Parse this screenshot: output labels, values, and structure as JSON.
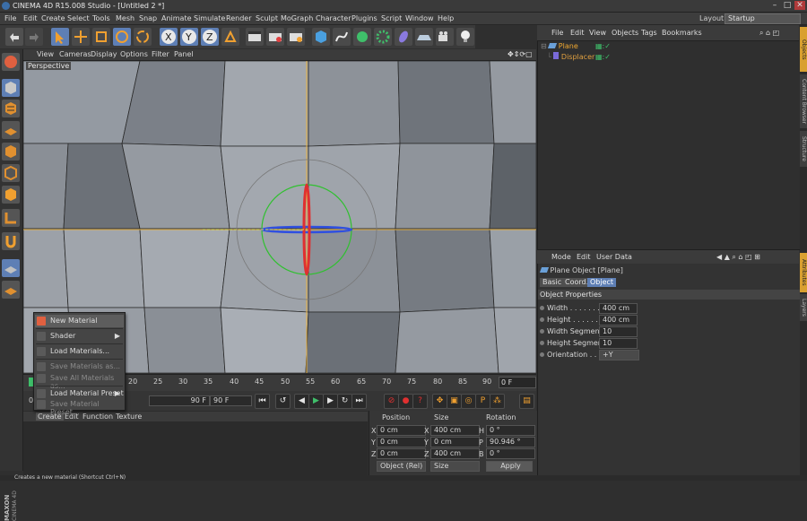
{
  "window": {
    "title": "CINEMA 4D R15.008 Studio - [Untitled 2 *]",
    "min": "–",
    "max": "□",
    "close": "✕"
  },
  "menubar": {
    "items": [
      "File",
      "Edit",
      "Create",
      "Select",
      "Tools",
      "Mesh",
      "Snap",
      "Animate",
      "Simulate",
      "Render",
      "Sculpt",
      "MoGraph",
      "Character",
      "Plugins",
      "Script",
      "Window",
      "Help"
    ],
    "layout_label": "Layout:",
    "layout_value": "Startup"
  },
  "viewport": {
    "menu": [
      "View",
      "Cameras",
      "Display",
      "Options",
      "Filter",
      "Panel"
    ],
    "label": "Perspective"
  },
  "timeline": {
    "ticks": [
      "20",
      "25",
      "30",
      "35",
      "40",
      "45",
      "50",
      "55",
      "60",
      "65",
      "70",
      "75",
      "80",
      "85",
      "90"
    ],
    "start_marker": "0",
    "frame_field": "0 F",
    "end_field_1": "90 F",
    "end_field_2": "90 F"
  },
  "context_menu": {
    "items": [
      {
        "label": "New Material",
        "highlight": true,
        "disabled": false,
        "sub": false
      },
      {
        "label": "Shader",
        "highlight": false,
        "disabled": false,
        "sub": true
      },
      {
        "label": "Load Materials...",
        "highlight": false,
        "disabled": false,
        "sub": false
      },
      {
        "label": "Save Materials as...",
        "highlight": false,
        "disabled": true,
        "sub": false
      },
      {
        "label": "Save All Materials as...",
        "highlight": false,
        "disabled": true,
        "sub": false
      },
      {
        "label": "Load Material Preset",
        "highlight": false,
        "disabled": false,
        "sub": true
      },
      {
        "label": "Save Material Preset...",
        "highlight": false,
        "disabled": true,
        "sub": false
      }
    ],
    "arrow": "▶"
  },
  "material_manager": {
    "menu": [
      "Create",
      "Edit",
      "Function",
      "Texture"
    ]
  },
  "coordinates": {
    "headers": [
      "Position",
      "Size",
      "Rotation"
    ],
    "rows": [
      {
        "axis": "X",
        "pos": "0 cm",
        "size_axis": "X",
        "size": "400 cm",
        "rot_axis": "H",
        "rot": "0 °"
      },
      {
        "axis": "Y",
        "pos": "0 cm",
        "size_axis": "Y",
        "size": "0 cm",
        "rot_axis": "P",
        "rot": "90.946 °"
      },
      {
        "axis": "Z",
        "pos": "0 cm",
        "size_axis": "Z",
        "size": "400 cm",
        "rot_axis": "B",
        "rot": "0 °"
      }
    ],
    "mode_select": "Object (Rel)",
    "size_select": "Size",
    "apply": "Apply"
  },
  "object_manager": {
    "menu": [
      "File",
      "Edit",
      "View",
      "Objects",
      "Tags",
      "Bookmarks"
    ],
    "objects": [
      {
        "name": "Plane",
        "indent": 0,
        "color": "#f0a830"
      },
      {
        "name": "Displacer",
        "indent": 1,
        "color": "#e0a040"
      }
    ]
  },
  "attributes": {
    "menu": [
      "Mode",
      "Edit",
      "User Data"
    ],
    "object_title": "Plane Object [Plane]",
    "tabs": [
      {
        "label": "Basic",
        "active": false
      },
      {
        "label": "Coord.",
        "active": false
      },
      {
        "label": "Object",
        "active": true
      }
    ],
    "section": "Object Properties",
    "props": [
      {
        "label": "Width . . . . . . . . .",
        "value": "400 cm"
      },
      {
        "label": "Height . . . . . . . . .",
        "value": "400 cm"
      },
      {
        "label": "Width Segments",
        "value": "10"
      },
      {
        "label": "Height Segments",
        "value": "10"
      },
      {
        "label": "Orientation . . . .",
        "value": "+Y"
      }
    ]
  },
  "side_tabs": [
    "Objects",
    "Content Browser",
    "Structure",
    "Attributes",
    "Layers"
  ],
  "brand": {
    "line1": "MAXON",
    "line2": "CINEMA 4D"
  },
  "status": "Creates a new material (Shortcut Ctrl+N)",
  "colors": {
    "accent": "#5e7fb5",
    "axis_x": "#e03030",
    "axis_y": "#30c030",
    "axis_z": "#3050e0",
    "selection": "#f0a830"
  }
}
